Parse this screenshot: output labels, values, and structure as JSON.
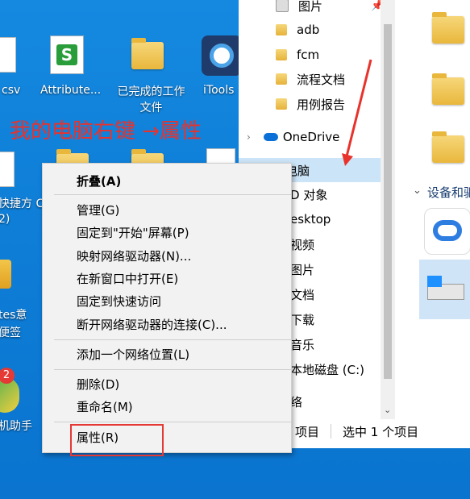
{
  "desktop": {
    "icons": [
      {
        "name": "csv",
        "label": "csv"
      },
      {
        "name": "attribute",
        "label": "Attribute..."
      },
      {
        "name": "completed-folder",
        "label": "已完成的工作\n文件"
      },
      {
        "name": "itools",
        "label": "iTools"
      },
      {
        "name": "shortcut",
        "label": "快捷方 C"
      },
      {
        "name": "num",
        "label": "2)"
      },
      {
        "name": "notes",
        "label": "tes意\n便签"
      },
      {
        "name": "phone-helper",
        "label": "机助手"
      }
    ],
    "annotation": "我的电脑右键 →属性"
  },
  "explorer": {
    "nav": [
      {
        "label": "图片",
        "pin": "📌"
      },
      {
        "label": "adb"
      },
      {
        "label": "fcm"
      },
      {
        "label": "流程文档"
      },
      {
        "label": "用例报告"
      },
      {
        "label": "OneDrive"
      },
      {
        "label": "电脑"
      },
      {
        "label": "D 对象"
      },
      {
        "label": "esktop"
      },
      {
        "label": "视频"
      },
      {
        "label": "图片"
      },
      {
        "label": "文档"
      },
      {
        "label": "下载"
      },
      {
        "label": "音乐"
      },
      {
        "label": "本地磁盘 (C:)"
      },
      {
        "label": "络"
      }
    ],
    "right": {
      "devices_label": "设备和驱"
    },
    "status": {
      "count": "项目",
      "selected": "选中 1 个项目"
    }
  },
  "context_menu": {
    "items": [
      {
        "label": "折叠(A)"
      },
      {
        "label": "管理(G)"
      },
      {
        "label": "固定到\"开始\"屏幕(P)"
      },
      {
        "label": "映射网络驱动器(N)..."
      },
      {
        "label": "在新窗口中打开(E)"
      },
      {
        "label": "固定到快速访问"
      },
      {
        "label": "断开网络驱动器的连接(C)..."
      },
      {
        "label": "添加一个网络位置(L)"
      },
      {
        "label": "删除(D)"
      },
      {
        "label": "重命名(M)"
      },
      {
        "label": "属性(R)"
      }
    ]
  },
  "colors": {
    "annotation": "#e8322c",
    "selection": "#cce4f7",
    "desktop": "#0f7fd8"
  }
}
